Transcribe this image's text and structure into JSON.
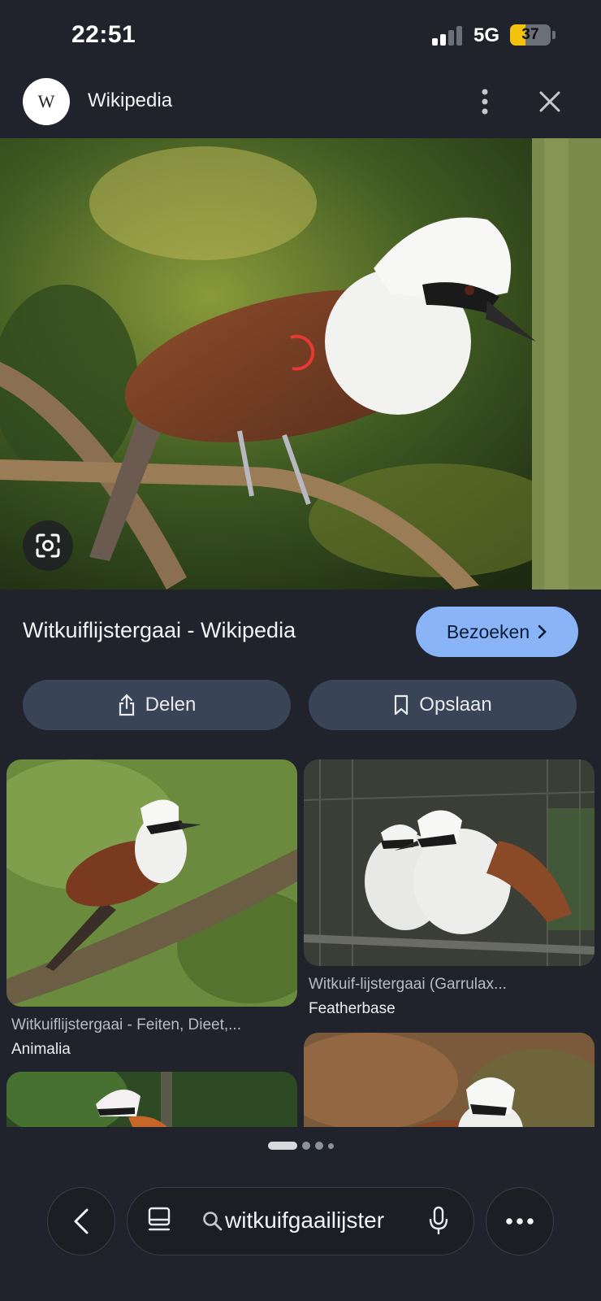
{
  "status_bar": {
    "time": "22:51",
    "network": "5G",
    "battery_percent": "37",
    "battery_level": 0.37,
    "battery_color": "#f4c20d"
  },
  "header": {
    "logo_letter": "W",
    "site_name": "Wikipedia"
  },
  "hero": {
    "icon": "google-lens-icon"
  },
  "result": {
    "title": "Witkuiflijstergaai - Wikipedia",
    "visit_label": "Bezoeken",
    "share_label": "Delen",
    "save_label": "Opslaan"
  },
  "related": [
    {
      "title": "Witkuiflijstergaai - Feiten, Dieet,...",
      "source": "Animalia"
    },
    {
      "title": "Witkuif-lijstergaai (Garrulax...",
      "source": "Featherbase"
    }
  ],
  "bottom_bar": {
    "query": "witkuifgaailijster",
    "page_dots": 4,
    "active_dot": 0
  },
  "colors": {
    "background": "#20232b",
    "accent_button": "#8ab4f8",
    "secondary_button": "#394457"
  }
}
